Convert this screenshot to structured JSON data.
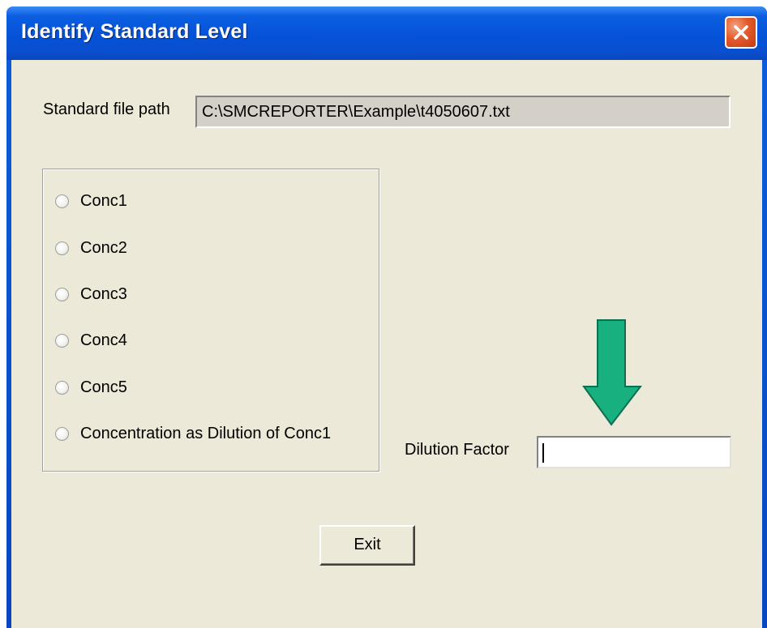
{
  "window": {
    "title": "Identify Standard Level"
  },
  "form": {
    "standard_file_path_label": "Standard file path",
    "standard_file_path_value": "C:\\SMCREPORTER\\Example\\t4050607.txt",
    "options": [
      {
        "label": "Conc1",
        "selected": false
      },
      {
        "label": "Conc2",
        "selected": false
      },
      {
        "label": "Conc3",
        "selected": false
      },
      {
        "label": "Conc4",
        "selected": false
      },
      {
        "label": "Conc5",
        "selected": false
      },
      {
        "label": "Concentration as Dilution of Conc1",
        "selected": false
      }
    ],
    "dilution_factor_label": "Dilution Factor",
    "dilution_factor_value": "",
    "exit_label": "Exit"
  },
  "icons": {
    "close": "close-icon",
    "annotation_arrow": "arrow-down-icon"
  },
  "colors": {
    "titlebar": "#0552d8",
    "client_bg": "#ece9d8",
    "close_button": "#e35a2a",
    "arrow_fill": "#19b07f",
    "path_box_bg": "#d4d0c8"
  }
}
